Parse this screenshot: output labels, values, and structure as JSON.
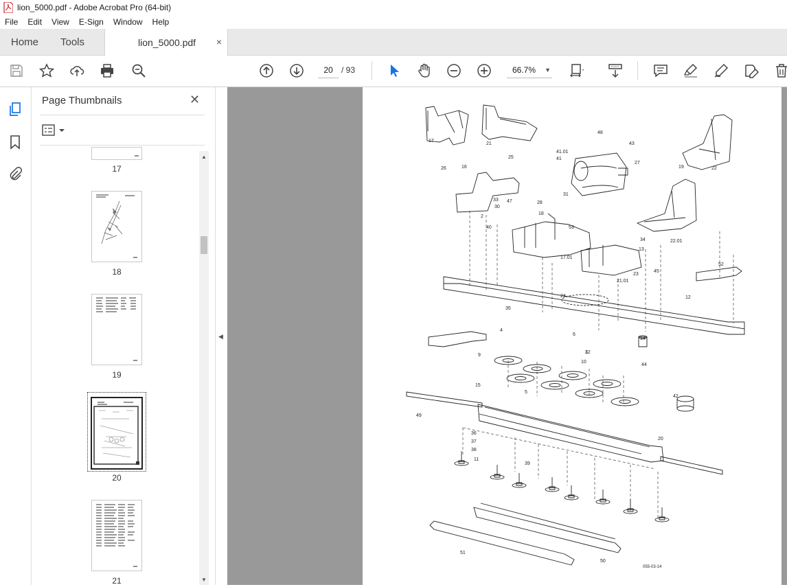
{
  "window": {
    "title": "lion_5000.pdf - Adobe Acrobat Pro (64-bit)"
  },
  "menu": {
    "items": [
      "File",
      "Edit",
      "View",
      "E-Sign",
      "Window",
      "Help"
    ]
  },
  "tabs": {
    "home": "Home",
    "tools": "Tools",
    "document": "lion_5000.pdf",
    "close": "×"
  },
  "toolbar": {
    "current_page": "20",
    "total_pages": "/ 93",
    "zoom": "66.7%",
    "icons": [
      "save-icon",
      "bookmark-star-icon",
      "upload-icon",
      "print-icon",
      "search-zoom-icon",
      "page-up-icon",
      "page-down-icon",
      "select-cursor-icon",
      "hand-icon",
      "zoom-out-icon",
      "zoom-in-icon",
      "fit-page-icon",
      "scroll-mode-icon",
      "comment-icon",
      "highlight-icon",
      "sign-icon",
      "edit-pdf-icon",
      "delete-icon"
    ]
  },
  "sidebar": {
    "title": "Page Thumbnails",
    "close": "✕",
    "thumbnails": [
      {
        "label": "17"
      },
      {
        "label": "18"
      },
      {
        "label": "19"
      },
      {
        "label": "20",
        "selected": true
      },
      {
        "label": "21"
      }
    ]
  },
  "drawing": {
    "code": "055-03-14",
    "part_labels": [
      "17",
      "21",
      "22",
      "16",
      "48",
      "43",
      "41.01",
      "41",
      "27",
      "25",
      "26",
      "19",
      "28",
      "31",
      "2",
      "40",
      "18",
      "33",
      "30",
      "47",
      "53",
      "17.01",
      "13",
      "34",
      "22.01",
      "21.01",
      "23",
      "45",
      "24",
      "35",
      "12",
      "52",
      "6",
      "32",
      "14",
      "4",
      "9",
      "10",
      "44",
      "15",
      "5",
      "42",
      "49",
      "20",
      "36",
      "37",
      "38",
      "39",
      "11",
      "51",
      "50",
      "1"
    ]
  },
  "colors": {
    "accent": "#1473e6",
    "doc_bg": "#999999",
    "tab_bar": "#e9e9e9"
  }
}
